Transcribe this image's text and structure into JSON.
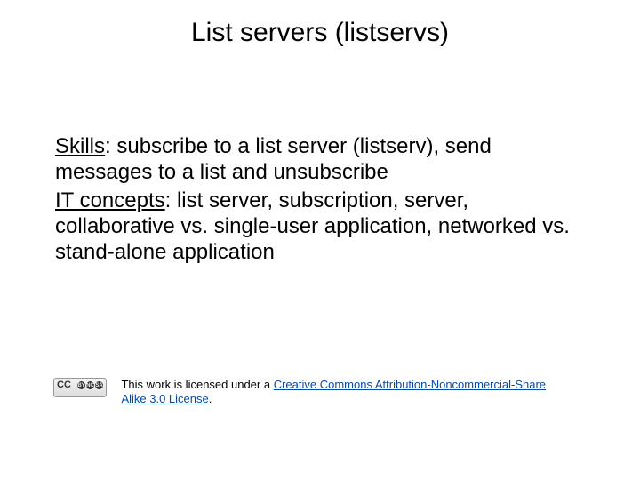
{
  "title": "List servers (listservs)",
  "body": {
    "skills_label": "Skills",
    "skills_text": ": subscribe to a list server (listserv), send messages to a list and unsubscribe",
    "it_label": "IT concepts",
    "it_text": ": list server, subscription, server, collaborative vs. single-user application, networked vs. stand-alone application"
  },
  "footer": {
    "prefix": "This work is licensed under a ",
    "link_text": "Creative Commons Attribution-Noncommercial-Share Alike 3.0 License",
    "suffix": "."
  },
  "cc": {
    "label": "CC",
    "by": "BY",
    "nc": "NC",
    "sa": "SA"
  }
}
